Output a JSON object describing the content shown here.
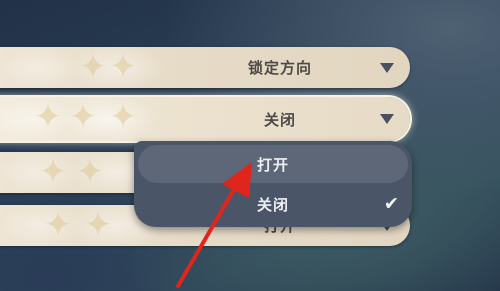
{
  "settings": [
    {
      "label": "锁定方向"
    },
    {
      "label": "关闭"
    },
    {
      "label": ""
    },
    {
      "label": "打开"
    }
  ],
  "dropdown": {
    "options": [
      "打开",
      "关闭"
    ],
    "selected": "关闭",
    "highlighted": "打开"
  },
  "icons": {
    "caret": "caret-down-icon",
    "check": "checkmark-icon",
    "annotation": "red-arrow"
  },
  "colors": {
    "row_bg": "#e7dcc8",
    "dropdown_bg": "#4a5568",
    "highlight_bg": "#5e6778",
    "annotation_arrow": "#e0251c"
  }
}
